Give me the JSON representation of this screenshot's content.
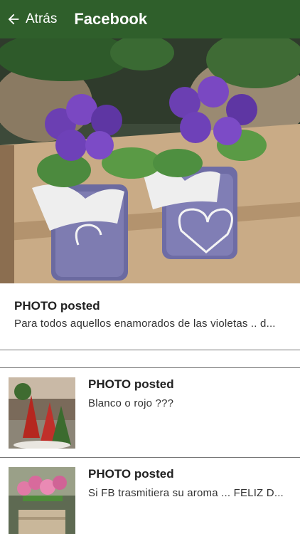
{
  "header": {
    "back_label": "Atrás",
    "title": "Facebook",
    "bar_color": "#2f5f2b"
  },
  "featured": {
    "type": "PHOTO posted",
    "text": "Para todos aquellos enamorados de las violetas .. d..."
  },
  "posts": [
    {
      "type": "PHOTO posted",
      "text": "Blanco o rojo ???"
    },
    {
      "type": "PHOTO posted",
      "text": "Si FB trasmitiera su aroma ... FELIZ D..."
    }
  ],
  "icons": {
    "back": "arrow-left-icon"
  }
}
